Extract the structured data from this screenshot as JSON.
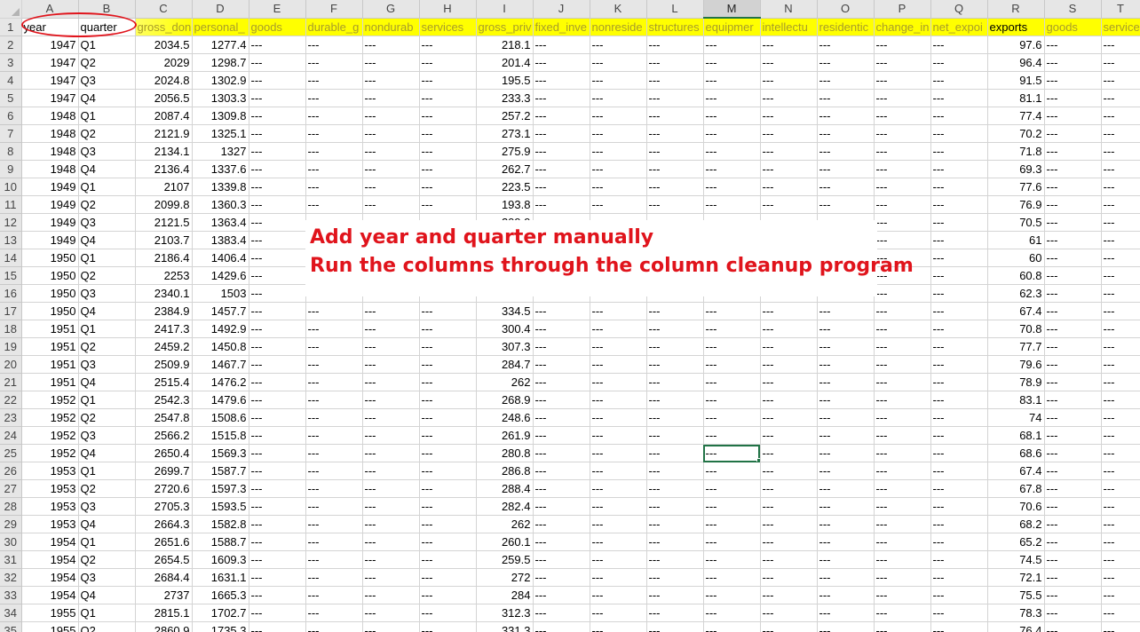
{
  "columns": [
    "A",
    "B",
    "C",
    "D",
    "E",
    "F",
    "G",
    "H",
    "I",
    "J",
    "K",
    "L",
    "M",
    "N",
    "O",
    "P",
    "Q",
    "R",
    "S",
    "T"
  ],
  "selected_column": "M",
  "row_numbers": [
    "1",
    "2",
    "3",
    "4",
    "5",
    "6",
    "7",
    "8",
    "9",
    "10",
    "11",
    "12",
    "13",
    "14",
    "15",
    "16",
    "17",
    "18",
    "19",
    "20",
    "21",
    "22",
    "23",
    "24",
    "25",
    "26",
    "27",
    "28",
    "29",
    "30",
    "31",
    "32",
    "33",
    "34",
    "35"
  ],
  "header_row": [
    "year",
    "quarter",
    "gross_don",
    "personal_",
    "goods",
    "durable_g",
    "nondurab",
    "services",
    "gross_priv",
    "fixed_inve",
    "nonreside",
    "structures",
    "equipmer",
    "intellectu",
    "residentic",
    "change_in",
    "net_expoi",
    "exports",
    "goods",
    "services"
  ],
  "placeholder": "---",
  "data_rows": [
    [
      "1947",
      "Q1",
      "2034.5",
      "1277.4",
      "218.1",
      "97.6"
    ],
    [
      "1947",
      "Q2",
      "2029",
      "1298.7",
      "201.4",
      "96.4"
    ],
    [
      "1947",
      "Q3",
      "2024.8",
      "1302.9",
      "195.5",
      "91.5"
    ],
    [
      "1947",
      "Q4",
      "2056.5",
      "1303.3",
      "233.3",
      "81.1"
    ],
    [
      "1948",
      "Q1",
      "2087.4",
      "1309.8",
      "257.2",
      "77.4"
    ],
    [
      "1948",
      "Q2",
      "2121.9",
      "1325.1",
      "273.1",
      "70.2"
    ],
    [
      "1948",
      "Q3",
      "2134.1",
      "1327",
      "275.9",
      "71.8"
    ],
    [
      "1948",
      "Q4",
      "2136.4",
      "1337.6",
      "262.7",
      "69.3"
    ],
    [
      "1949",
      "Q1",
      "2107",
      "1339.8",
      "223.5",
      "77.6"
    ],
    [
      "1949",
      "Q2",
      "2099.8",
      "1360.3",
      "193.8",
      "76.9"
    ],
    [
      "1949",
      "Q3",
      "2121.5",
      "1363.4",
      "209.9",
      "70.5"
    ],
    [
      "1949",
      "Q4",
      "2103.7",
      "1383.4",
      "",
      "61"
    ],
    [
      "1950",
      "Q1",
      "2186.4",
      "1406.4",
      "",
      "60"
    ],
    [
      "1950",
      "Q2",
      "2253",
      "1429.6",
      "",
      "60.8"
    ],
    [
      "1950",
      "Q3",
      "2340.1",
      "1503",
      "",
      "62.3"
    ],
    [
      "1950",
      "Q4",
      "2384.9",
      "1457.7",
      "334.5",
      "67.4"
    ],
    [
      "1951",
      "Q1",
      "2417.3",
      "1492.9",
      "300.4",
      "70.8"
    ],
    [
      "1951",
      "Q2",
      "2459.2",
      "1450.8",
      "307.3",
      "77.7"
    ],
    [
      "1951",
      "Q3",
      "2509.9",
      "1467.7",
      "284.7",
      "79.6"
    ],
    [
      "1951",
      "Q4",
      "2515.4",
      "1476.2",
      "262",
      "78.9"
    ],
    [
      "1952",
      "Q1",
      "2542.3",
      "1479.6",
      "268.9",
      "83.1"
    ],
    [
      "1952",
      "Q2",
      "2547.8",
      "1508.6",
      "248.6",
      "74"
    ],
    [
      "1952",
      "Q3",
      "2566.2",
      "1515.8",
      "261.9",
      "68.1"
    ],
    [
      "1952",
      "Q4",
      "2650.4",
      "1569.3",
      "280.8",
      "68.6"
    ],
    [
      "1953",
      "Q1",
      "2699.7",
      "1587.7",
      "286.8",
      "67.4"
    ],
    [
      "1953",
      "Q2",
      "2720.6",
      "1597.3",
      "288.4",
      "67.8"
    ],
    [
      "1953",
      "Q3",
      "2705.3",
      "1593.5",
      "282.4",
      "70.6"
    ],
    [
      "1953",
      "Q4",
      "2664.3",
      "1582.8",
      "262",
      "68.2"
    ],
    [
      "1954",
      "Q1",
      "2651.6",
      "1588.7",
      "260.1",
      "65.2"
    ],
    [
      "1954",
      "Q2",
      "2654.5",
      "1609.3",
      "259.5",
      "74.5"
    ],
    [
      "1954",
      "Q3",
      "2684.4",
      "1631.1",
      "272",
      "72.1"
    ],
    [
      "1954",
      "Q4",
      "2737",
      "1665.3",
      "284",
      "75.5"
    ],
    [
      "1955",
      "Q1",
      "2815.1",
      "1702.7",
      "312.3",
      "78.3"
    ],
    [
      "1955",
      "Q2",
      "2860.9",
      "1735.3",
      "331.3",
      "76.4"
    ]
  ],
  "active_cell": "M25",
  "annotation": {
    "line1": "Add year and quarter manually",
    "line2": "Run the columns through the column cleanup program"
  },
  "colors": {
    "header_highlight": "#ffff00",
    "annotation_red": "#e0141c",
    "selection_green": "#217346"
  }
}
